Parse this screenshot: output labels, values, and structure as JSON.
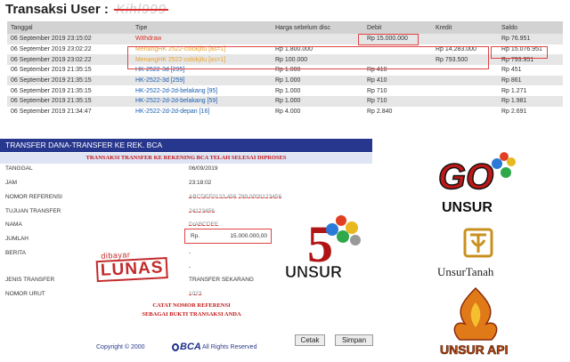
{
  "page": {
    "title": "Transaksi User :",
    "user_redacted": "Kihl999"
  },
  "table": {
    "headers": [
      "Tanggal",
      "Tipe",
      "Harga sebelum disc",
      "Debit",
      "Kredit",
      "Saldo"
    ],
    "rows": [
      {
        "date": "06 September 2019 23:15:02",
        "type_prefix": "",
        "type": "Withdraw",
        "type_style": "withdraw",
        "harga": "",
        "debit": "Rp 15.000.000",
        "kredit": "",
        "saldo": "Rp 76.951"
      },
      {
        "date": "06 September 2019 23:02:22",
        "type_prefix": "Menang",
        "type": "HK 2522-colokjitu [as=1]",
        "type_style": "win",
        "harga": "Rp 1.800.000",
        "debit": "",
        "kredit": "Rp 14.283.000",
        "saldo": "Rp 15.076.951"
      },
      {
        "date": "06 September 2019 23:02:22",
        "type_prefix": "Menang",
        "type": "HK 2522-colokjitu [as=1]",
        "type_style": "win",
        "harga": "Rp 100.000",
        "debit": "",
        "kredit": "Rp 793.500",
        "saldo": "Rp 793.951"
      },
      {
        "date": "06 September 2019 21:35:15",
        "type_prefix": "",
        "type": "HK-2522-3d [295]",
        "type_style": "link",
        "harga": "Rp 1.000",
        "debit": "Rp 410",
        "kredit": "",
        "saldo": "Rp 451"
      },
      {
        "date": "06 September 2019 21:35:15",
        "type_prefix": "",
        "type": "HK-2522-3d [259]",
        "type_style": "link",
        "harga": "Rp 1.000",
        "debit": "Rp 410",
        "kredit": "",
        "saldo": "Rp 861"
      },
      {
        "date": "06 September 2019 21:35:15",
        "type_prefix": "",
        "type": "HK-2522-2d-2d-belakang [95]",
        "type_style": "link",
        "harga": "Rp 1.000",
        "debit": "Rp 710",
        "kredit": "",
        "saldo": "Rp 1.271"
      },
      {
        "date": "06 September 2019 21:35:15",
        "type_prefix": "",
        "type": "HK-2522-2d-2d-belakang [59]",
        "type_style": "link",
        "harga": "Rp 1.000",
        "debit": "Rp 710",
        "kredit": "",
        "saldo": "Rp 1.981"
      },
      {
        "date": "06 September 2019 21:34:47",
        "type_prefix": "",
        "type": "HK-2522-2d-2d-depan [16]",
        "type_style": "link",
        "harga": "Rp 4.000",
        "debit": "Rp 2.840",
        "kredit": "",
        "saldo": "Rp 2.691"
      }
    ]
  },
  "bca": {
    "header": "TRANSFER DANA-TRANSFER KE REK. BCA",
    "status": "TRANSAKSI TRANSFER KE REKENING BCA TELAH SELESAI DIPROSES",
    "fields": [
      {
        "label": "TANGGAL",
        "value": "06/09/2019"
      },
      {
        "label": "JAM",
        "value": "23:18:02"
      },
      {
        "label": "NOMOR REFERENSI",
        "value": "ABCDEF0123 456 789 0000123456"
      },
      {
        "label": "TUJUAN TRANSFER",
        "value": "24123456"
      },
      {
        "label": "NAMA",
        "value": "D/ABCDEF"
      },
      {
        "label": "JUMLAH",
        "value": ""
      },
      {
        "label": "BERITA",
        "value": "-"
      },
      {
        "label": "",
        "value": "-"
      },
      {
        "label": "JENIS TRANSFER",
        "value": "TRANSFER SEKARANG"
      },
      {
        "label": "NOMOR URUT",
        "value": "1023"
      }
    ],
    "amount_currency": "Rp.",
    "amount_value": "15.000.000,00",
    "note_line1": "CATAT NOMOR REFERENSI",
    "note_line2": "SEBAGAI BUKTI TRANSAKSI ANDA",
    "print_button": "Cetak",
    "save_button": "Simpan",
    "copyright": "Copyright © 2000",
    "bank_logo": "BCA",
    "rights": "All Rights Reserved"
  },
  "stamp": {
    "top": "dibayar",
    "main": "LUNAS"
  },
  "logos": {
    "go_text": "GO",
    "go_sub": "UNSUR",
    "five_text": "UNSUR",
    "tanah_text": "UnsurTanah",
    "api_text": "UNSUR API"
  },
  "colors": {
    "header_bg": "#d2d2d2",
    "row_alt": "#e6e6e6",
    "bca_blue": "#28378e",
    "red_accent": "#c01515",
    "win_orange": "#e8a02a",
    "link_blue": "#1a5fb4"
  }
}
